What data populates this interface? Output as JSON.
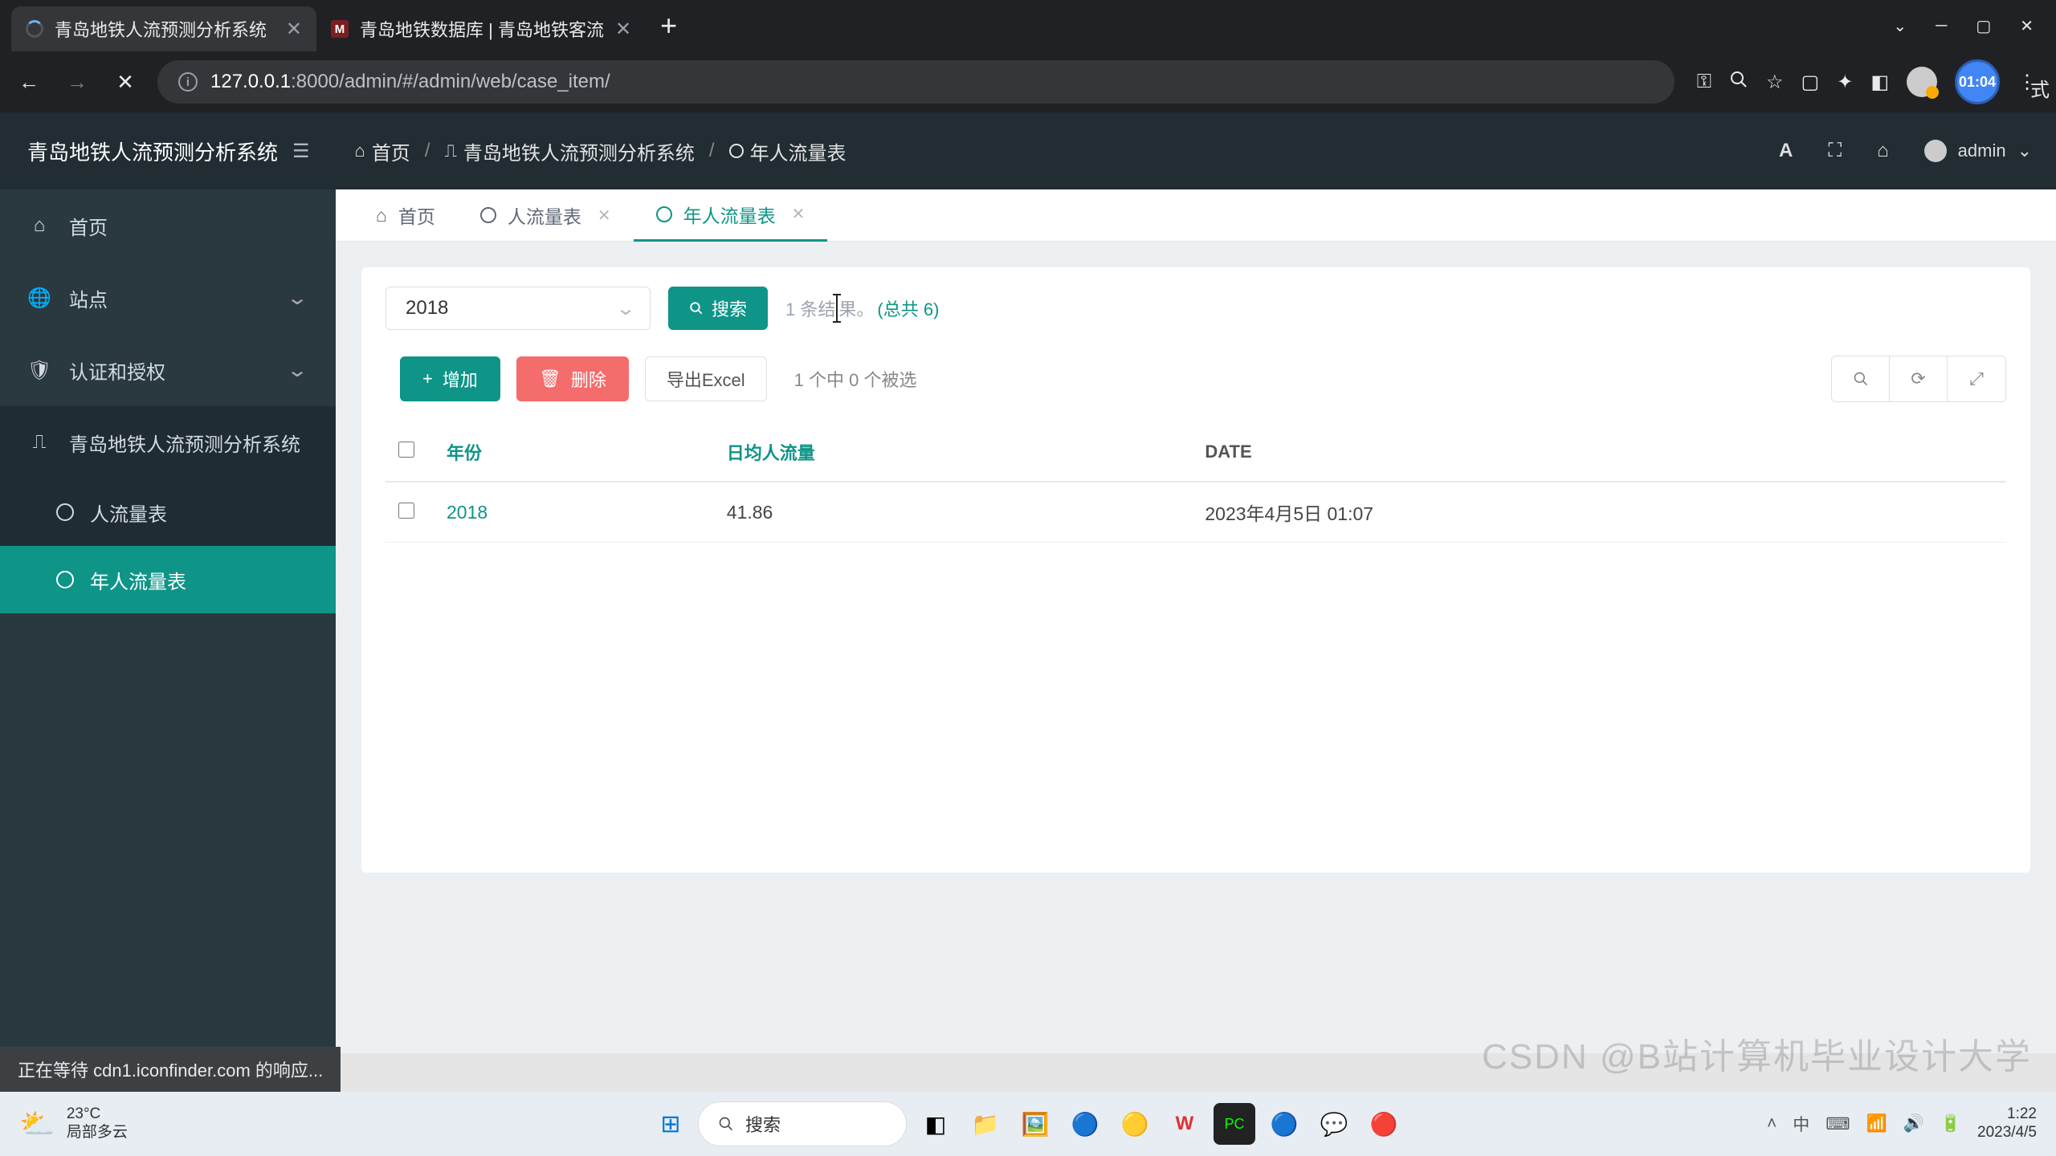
{
  "browser": {
    "tabs": [
      {
        "title": "青岛地铁人流预测分析系统"
      },
      {
        "title": "青岛地铁数据库 | 青岛地铁客流"
      }
    ],
    "url_host": "127.0.0.1",
    "url_path": ":8000/admin/#/admin/web/case_item/",
    "timer": "01:04",
    "ext_hint": "式"
  },
  "header": {
    "title": "青岛地铁人流预测分析系统",
    "crumbs": {
      "home": "首页",
      "system": "青岛地铁人流预测分析系统",
      "current": "年人流量表"
    },
    "user": "admin"
  },
  "sidebar": {
    "home": "首页",
    "site": "站点",
    "auth": "认证和授权",
    "system": "青岛地铁人流预测分析系统",
    "flow": "人流量表",
    "yearflow": "年人流量表"
  },
  "tabs": {
    "home": "首页",
    "flow": "人流量表",
    "yearflow": "年人流量表"
  },
  "search": {
    "year": "2018",
    "button": "搜索",
    "result_prefix": "1 条结",
    "result_suffix": "果。",
    "total": "(总共 6)"
  },
  "actions": {
    "add": "增加",
    "delete": "删除",
    "export": "导出Excel",
    "selected": "1 个中 0 个被选"
  },
  "table": {
    "headers": {
      "year": "年份",
      "avg": "日均人流量",
      "date": "DATE"
    },
    "row": {
      "year": "2018",
      "avg": "41.86",
      "date": "2023年4月5日 01:07"
    }
  },
  "status": "正在等待 cdn1.iconfinder.com 的响应...",
  "taskbar": {
    "temp": "23°C",
    "weather": "局部多云",
    "search": "搜索",
    "time": "1:22",
    "date": "2023/4/5"
  },
  "watermark": "CSDN @B站计算机毕业设计大学"
}
